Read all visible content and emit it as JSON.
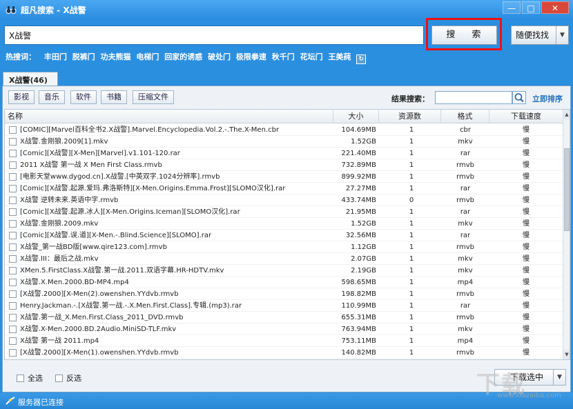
{
  "window": {
    "title": "超凡搜索 - X战警",
    "controls": {
      "minimize": "—",
      "maximize": "□",
      "close": "✕"
    }
  },
  "search": {
    "query": "X战警",
    "button_label": "搜 索",
    "random_label": "随便找找",
    "hot_label": "热搜词：",
    "hot_words": [
      "丰田门",
      "脱裤门",
      "功夫熊猫",
      "电梯门",
      "回家的诱惑",
      "破处门",
      "极限拳速",
      "秋千门",
      "花坛门",
      "王美莼"
    ]
  },
  "tabs": [
    {
      "label": "X战警(46)"
    }
  ],
  "filters": {
    "categories": [
      "影视",
      "音乐",
      "软件",
      "书籍",
      "压缩文件"
    ],
    "result_search_label": "结果搜索：",
    "sort_label": "立即排序"
  },
  "table": {
    "columns": {
      "name": "名称",
      "size": "大小",
      "sources": "资源数",
      "format": "格式",
      "speed": "下载速度"
    },
    "rows": [
      {
        "name": "[COMIC][Marvel百科全书2.X战警].Marvel.Encyclopedia.Vol.2.-.The.X-Men.cbr",
        "size": "104.69MB",
        "sources": "1",
        "format": "cbr",
        "speed": "慢"
      },
      {
        "name": "X战警.金刚狼.2009[1].mkv",
        "size": "1.52GB",
        "sources": "1",
        "format": "mkv",
        "speed": "慢"
      },
      {
        "name": "[Comic][X战警][X-Men][Marvel].v1.101-120.rar",
        "size": "221.40MB",
        "sources": "1",
        "format": "rar",
        "speed": "慢"
      },
      {
        "name": "2011 X战警 第一战 X Men First Class.rmvb",
        "size": "732.89MB",
        "sources": "1",
        "format": "rmvb",
        "speed": "慢"
      },
      {
        "name": "[电影天堂www.dygod.cn].X战警.[中英双字.1024分辨率].rmvb",
        "size": "899.92MB",
        "sources": "1",
        "format": "rmvb",
        "speed": "慢"
      },
      {
        "name": "[Comic][X战警.起源.爱玛.弗洛斯特][X-Men.Origins.Emma.Frost][SLOMO汉化].rar",
        "size": "27.27MB",
        "sources": "1",
        "format": "rar",
        "speed": "慢"
      },
      {
        "name": "X战警 逆转未来.英语中字.rmvb",
        "size": "433.74MB",
        "sources": "0",
        "format": "rmvb",
        "speed": "慢"
      },
      {
        "name": "[Comic][X战警.起源.冰人][X-Men.Origins.Iceman][SLOMO汉化].rar",
        "size": "21.95MB",
        "sources": "1",
        "format": "rar",
        "speed": "慢"
      },
      {
        "name": "X战警.金刚狼.2009.mkv",
        "size": "1.52GB",
        "sources": "1",
        "format": "mkv",
        "speed": "慢"
      },
      {
        "name": "[Comic][X战警.误.道][X-Men.-.Blind.Science][SLOMO].rar",
        "size": "32.56MB",
        "sources": "1",
        "format": "rar",
        "speed": "慢"
      },
      {
        "name": "X战警_第一战BD版[www.qire123.com].rmvb",
        "size": "1.12GB",
        "sources": "1",
        "format": "rmvb",
        "speed": "慢"
      },
      {
        "name": "X战警.III：最后之战.mkv",
        "size": "2.07GB",
        "sources": "1",
        "format": "mkv",
        "speed": "慢"
      },
      {
        "name": "XMen.5.FirstClass.X战警.第一战.2011.双语字幕.HR-HDTV.mkv",
        "size": "2.19GB",
        "sources": "1",
        "format": "mkv",
        "speed": "慢"
      },
      {
        "name": "X战警.X.Men.2000.BD-MP4.mp4",
        "size": "598.65MB",
        "sources": "1",
        "format": "mp4",
        "speed": "慢"
      },
      {
        "name": "[X战警.2000][X-Men(2).owenshen.YYdvb.rmvb",
        "size": "198.82MB",
        "sources": "1",
        "format": "rmvb",
        "speed": "慢"
      },
      {
        "name": "Henry.Jackman.-.[X战警.第一战.-.X.Men.First.Class].专辑.(mp3).rar",
        "size": "110.99MB",
        "sources": "1",
        "format": "rar",
        "speed": "慢"
      },
      {
        "name": "X战警.第一战_X.Men.First.Class_2011_DVD.rmvb",
        "size": "655.31MB",
        "sources": "1",
        "format": "rmvb",
        "speed": "慢"
      },
      {
        "name": "X战警.X-Men.2000.BD.2Audio.MiniSD-TLF.mkv",
        "size": "763.94MB",
        "sources": "1",
        "format": "mkv",
        "speed": "慢"
      },
      {
        "name": "X战警 第一战 2011.mp4",
        "size": "753.11MB",
        "sources": "1",
        "format": "mp4",
        "speed": "慢"
      },
      {
        "name": "[X战警.2000][X-Men(1).owenshen.YYdvb.rmvb",
        "size": "140.82MB",
        "sources": "1",
        "format": "rmvb",
        "speed": "慢"
      }
    ]
  },
  "bottom": {
    "select_all": "全选",
    "invert": "反选",
    "download_label": "下载选中"
  },
  "status": {
    "text": "服务器已连接"
  },
  "watermark": {
    "big": "下载",
    "small": "www.xiazaiba.com"
  }
}
